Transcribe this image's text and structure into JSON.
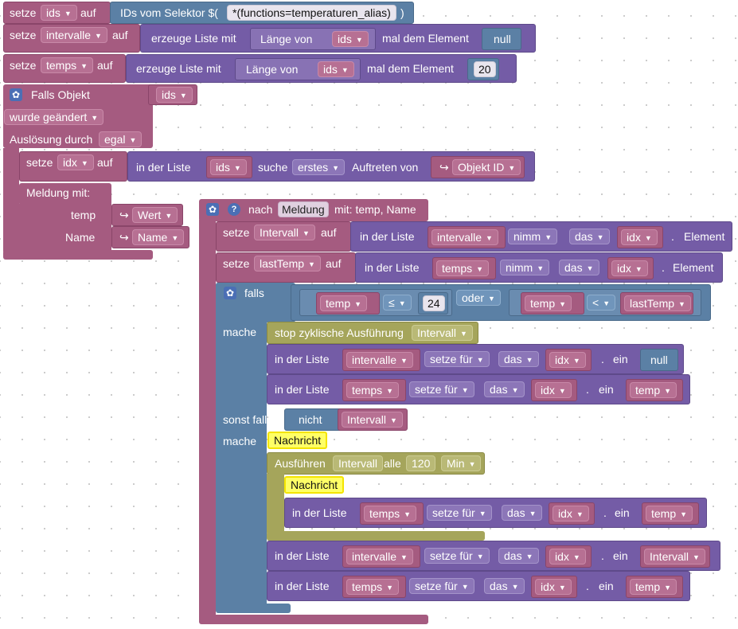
{
  "workspace": {
    "b1": {
      "setze": "setze",
      "var": "ids",
      "auf": "auf",
      "selector": "IDs vom Selektor $(",
      "selector_value": "*(functions=temperaturen_alias)",
      "close": ")"
    },
    "b2": {
      "setze": "setze",
      "var": "intervalle",
      "auf": "auf",
      "create": "erzeuge Liste mit",
      "length": "Länge von",
      "lenvar": "ids",
      "times": "mal dem Element",
      "value": "null"
    },
    "b3": {
      "setze": "setze",
      "var": "temps",
      "auf": "auf",
      "create": "erzeuge Liste mit",
      "length": "Länge von",
      "lenvar": "ids",
      "times": "mal dem Element",
      "value": "20"
    },
    "trigger": {
      "title": "Falls Objekt",
      "obj": "ids",
      "changed": "wurde geändert",
      "by_label": "Auslösung durch",
      "by_value": "egal",
      "setidx": {
        "setze": "setze",
        "var": "idx",
        "auf": "auf",
        "inlist": "in der Liste",
        "listvar": "ids",
        "find": "suche",
        "mode": "erstes",
        "occurrence": "Auftreten von",
        "objid": "Objekt ID"
      },
      "message": {
        "label": "Meldung  mit:",
        "p1_label": "temp",
        "p1_value": "Wert",
        "p2_label": "Name",
        "p2_value": "Name"
      }
    },
    "handler": {
      "title_nach": "nach",
      "title_msg": "Meldung",
      "title_rest": "mit: temp, Name",
      "s1": {
        "setze": "setze",
        "var": "Intervall",
        "auf": "auf",
        "inlist": "in der Liste",
        "listvar": "intervalle",
        "op": "nimm",
        "which": "das",
        "idx": "idx",
        "elem": "Element"
      },
      "s2": {
        "setze": "setze",
        "var": "lastTemp",
        "auf": "auf",
        "inlist": "in der Liste",
        "listvar": "temps",
        "op": "nimm",
        "which": "das",
        "idx": "idx",
        "elem": "Element"
      },
      "ifblock": {
        "falls": "falls",
        "c1_var": "temp",
        "c1_op": "≤",
        "c1_num": "24",
        "or": "oder",
        "c2_var": "temp",
        "c2_op": "<",
        "c2_rhs": "lastTemp",
        "mache": "mache",
        "stop": "stop zyklische Ausführung",
        "stop_var": "Intervall",
        "l1": {
          "inlist": "in der Liste",
          "listvar": "intervalle",
          "op": "setze für",
          "which": "das",
          "idx": "idx",
          "ein": "ein",
          "value": "null"
        },
        "l2": {
          "inlist": "in der Liste",
          "listvar": "temps",
          "op": "setze für",
          "which": "das",
          "idx": "idx",
          "ein": "ein",
          "value": "temp"
        },
        "elseif": "sonst falls",
        "not": "nicht",
        "not_var": "Intervall",
        "mache2": "mache",
        "nachricht1": "Nachricht",
        "exec": {
          "label": "Ausführen",
          "var": "Intervall",
          "every": "alle",
          "num": "120",
          "unit": "Min"
        },
        "nachricht2": "Nachricht",
        "l3": {
          "inlist": "in der Liste",
          "listvar": "temps",
          "op": "setze für",
          "which": "das",
          "idx": "idx",
          "ein": "ein",
          "value": "temp"
        },
        "l4": {
          "inlist": "in der Liste",
          "listvar": "intervalle",
          "op": "setze für",
          "which": "das",
          "idx": "idx",
          "ein": "ein",
          "value": "Intervall"
        },
        "l5": {
          "inlist": "in der Liste",
          "listvar": "temps",
          "op": "setze für",
          "which": "das",
          "idx": "idx",
          "ein": "ein",
          "value": "temp"
        }
      }
    }
  },
  "colors": {
    "variables": "#a55b80",
    "lists": "#745ca6",
    "logic": "#5b80a5",
    "timers": "#a5a55b",
    "comment": "#ffff66"
  }
}
